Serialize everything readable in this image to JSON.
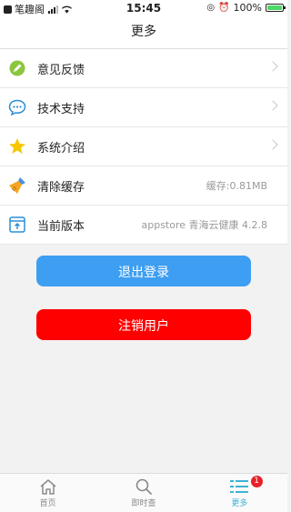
{
  "status_bar": {
    "carrier": "笔趣阁",
    "time": "15:45",
    "battery": "100%",
    "battery_level": 1.0
  },
  "header": {
    "title": "更多"
  },
  "menu": [
    {
      "label": "意见反馈",
      "icon": "edit-icon",
      "value": ""
    },
    {
      "label": "技术支持",
      "icon": "chat-icon",
      "value": ""
    },
    {
      "label": "系统介绍",
      "icon": "star-icon",
      "value": ""
    },
    {
      "label": "清除缓存",
      "icon": "broom-icon",
      "value": "缓存:0.81MB"
    },
    {
      "label": "当前版本",
      "icon": "upload-box-icon",
      "value": "appstore 青海云健康 4.2.8"
    }
  ],
  "buttons": {
    "logout": "退出登录",
    "cancel_account": "注销用户"
  },
  "tabs": [
    {
      "label": "首页",
      "icon": "home-icon"
    },
    {
      "label": "即时查",
      "icon": "search-icon"
    },
    {
      "label": "更多",
      "icon": "menu-grid-icon",
      "badge": "1"
    }
  ],
  "colors": {
    "primary_button": "#3d9ef2",
    "danger_button": "#ff0000",
    "active_tab": "#3db3d6",
    "badge": "#e8202a"
  }
}
